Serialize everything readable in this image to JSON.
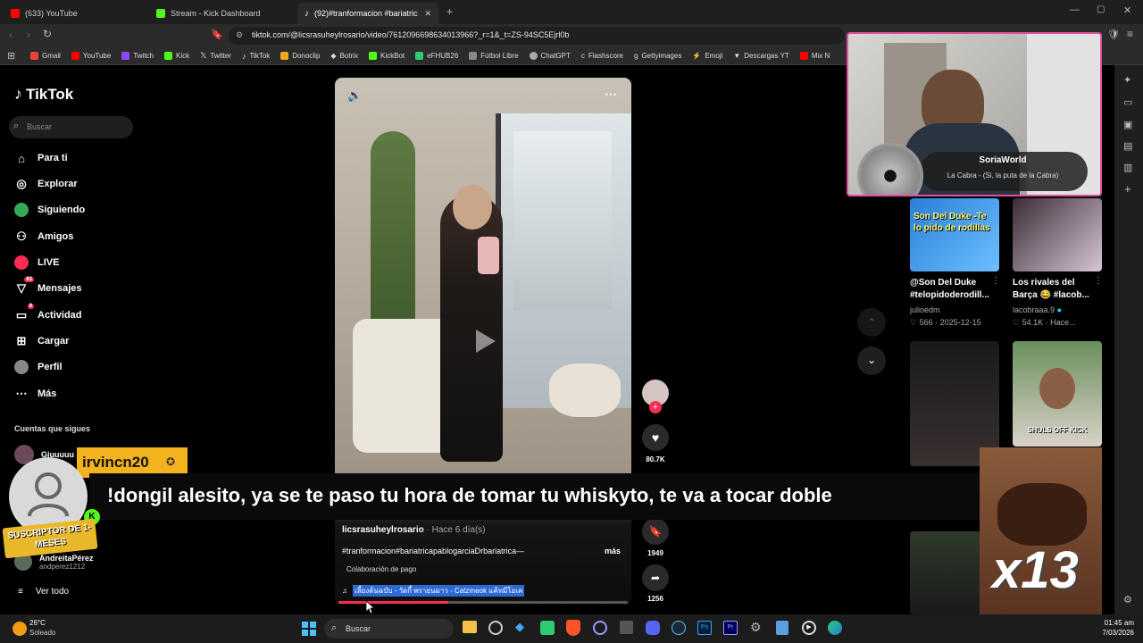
{
  "browser": {
    "tabs": [
      {
        "label": "(633) YouTube",
        "color": "#ff0000"
      },
      {
        "label": "Stream - Kick Dashboard",
        "color": "#53fc18"
      },
      {
        "label": "(92)#tranformacion #bariatric",
        "color": "#ffffff",
        "active": true
      }
    ],
    "url": "tiktok.com/@licsrasuheylrosario/video/7612096698634013966?_r=1&_t=ZS-94SC5Ejrl0b",
    "bookmarks": [
      {
        "label": "Gmail",
        "color": "#ea4335"
      },
      {
        "label": "YouTube",
        "color": "#ff0000"
      },
      {
        "label": "Twitch",
        "color": "#9146ff"
      },
      {
        "label": "Kick",
        "color": "#53fc18"
      },
      {
        "label": "Twitter",
        "color": "#ffffff"
      },
      {
        "label": "TikTok",
        "color": "#ffffff"
      },
      {
        "label": "Donoclip",
        "color": "#f5a623"
      },
      {
        "label": "Botrix",
        "color": "#cccccc"
      },
      {
        "label": "KickBot",
        "color": "#53fc18"
      },
      {
        "label": "eFHUB26",
        "color": "#2ecc71"
      },
      {
        "label": "Fútbol Libre",
        "color": "#dddddd"
      },
      {
        "label": "ChatGPT",
        "color": "#dddddd"
      },
      {
        "label": "Flashscore",
        "color": "#dddddd"
      },
      {
        "label": "Gettyimages",
        "color": "#dddddd"
      },
      {
        "label": "Emoji",
        "color": "#fe2c55"
      },
      {
        "label": "Descargas YT",
        "color": "#ccaa88"
      },
      {
        "label": "Mix N",
        "color": "#ff0000"
      }
    ]
  },
  "tiktok": {
    "logo": "TikTok",
    "search_placeholder": "Buscar",
    "nav": [
      {
        "label": "Para ti",
        "icon": "home-icon"
      },
      {
        "label": "Explorar",
        "icon": "compass-icon"
      },
      {
        "label": "Siguiendo",
        "icon": "following-icon"
      },
      {
        "label": "Amigos",
        "icon": "friends-icon"
      },
      {
        "label": "LIVE",
        "icon": "live-icon"
      },
      {
        "label": "Mensajes",
        "icon": "messages-icon",
        "badge": "83"
      },
      {
        "label": "Actividad",
        "icon": "activity-icon",
        "badge": "9"
      },
      {
        "label": "Cargar",
        "icon": "upload-icon"
      },
      {
        "label": "Perfil",
        "icon": "profile-icon"
      },
      {
        "label": "Más",
        "icon": "more-icon"
      }
    ],
    "following_title": "Cuentas que sigues",
    "following": [
      {
        "name": "Giuuuuu"
      },
      {
        "name": "AndreitaPérez",
        "handle": "andperez1212"
      }
    ],
    "see_all": "Ver todo"
  },
  "video": {
    "author": "licsrasuheylrosario",
    "age": "· Hace 6 día(s)",
    "caption": "#tranformacion#bariatricapablogarciaDrbariatrica—",
    "more": "más",
    "paid": "Colaboración de pago",
    "music": "เลี้ยงต้นฉบับ - วัดกี้ พรายนมาว - Catzmeok แค้ทมีโอเค",
    "likes": "80.7K",
    "saves": "1949",
    "shares": "1256",
    "progress": 0.38
  },
  "recommendations": [
    {
      "title": "@Son Del Duke #telopidoderodill...",
      "author": "julioedm",
      "likes": "566",
      "date": "2025-12-15",
      "thumb_text": "Son Del Duke -Te lo pido de rodillas"
    },
    {
      "title": "Los rivales del Barça 😂 #lacob...",
      "author": "lacobraaa.9",
      "likes": "54.1K",
      "date": "Hace..."
    }
  ],
  "stream": {
    "streamer": "SoriaWorld",
    "song": "La Cabra - (Si, la puta de la Cabra)",
    "chat_user": "irvincn20",
    "chat_message": "!dongil alesito, ya se te paso tu hora de tomar tu whiskyto, te va a tocar doble",
    "sub_badge": "SUSCRIPTOR DE 1-MESES",
    "multiplier": "x13",
    "kick_overlay": "SHULS OFF KICK"
  },
  "taskbar": {
    "temp": "26°C",
    "weather": "Soleado",
    "search": "Buscar",
    "time": "01:45 am",
    "date": "7/03/2026"
  }
}
